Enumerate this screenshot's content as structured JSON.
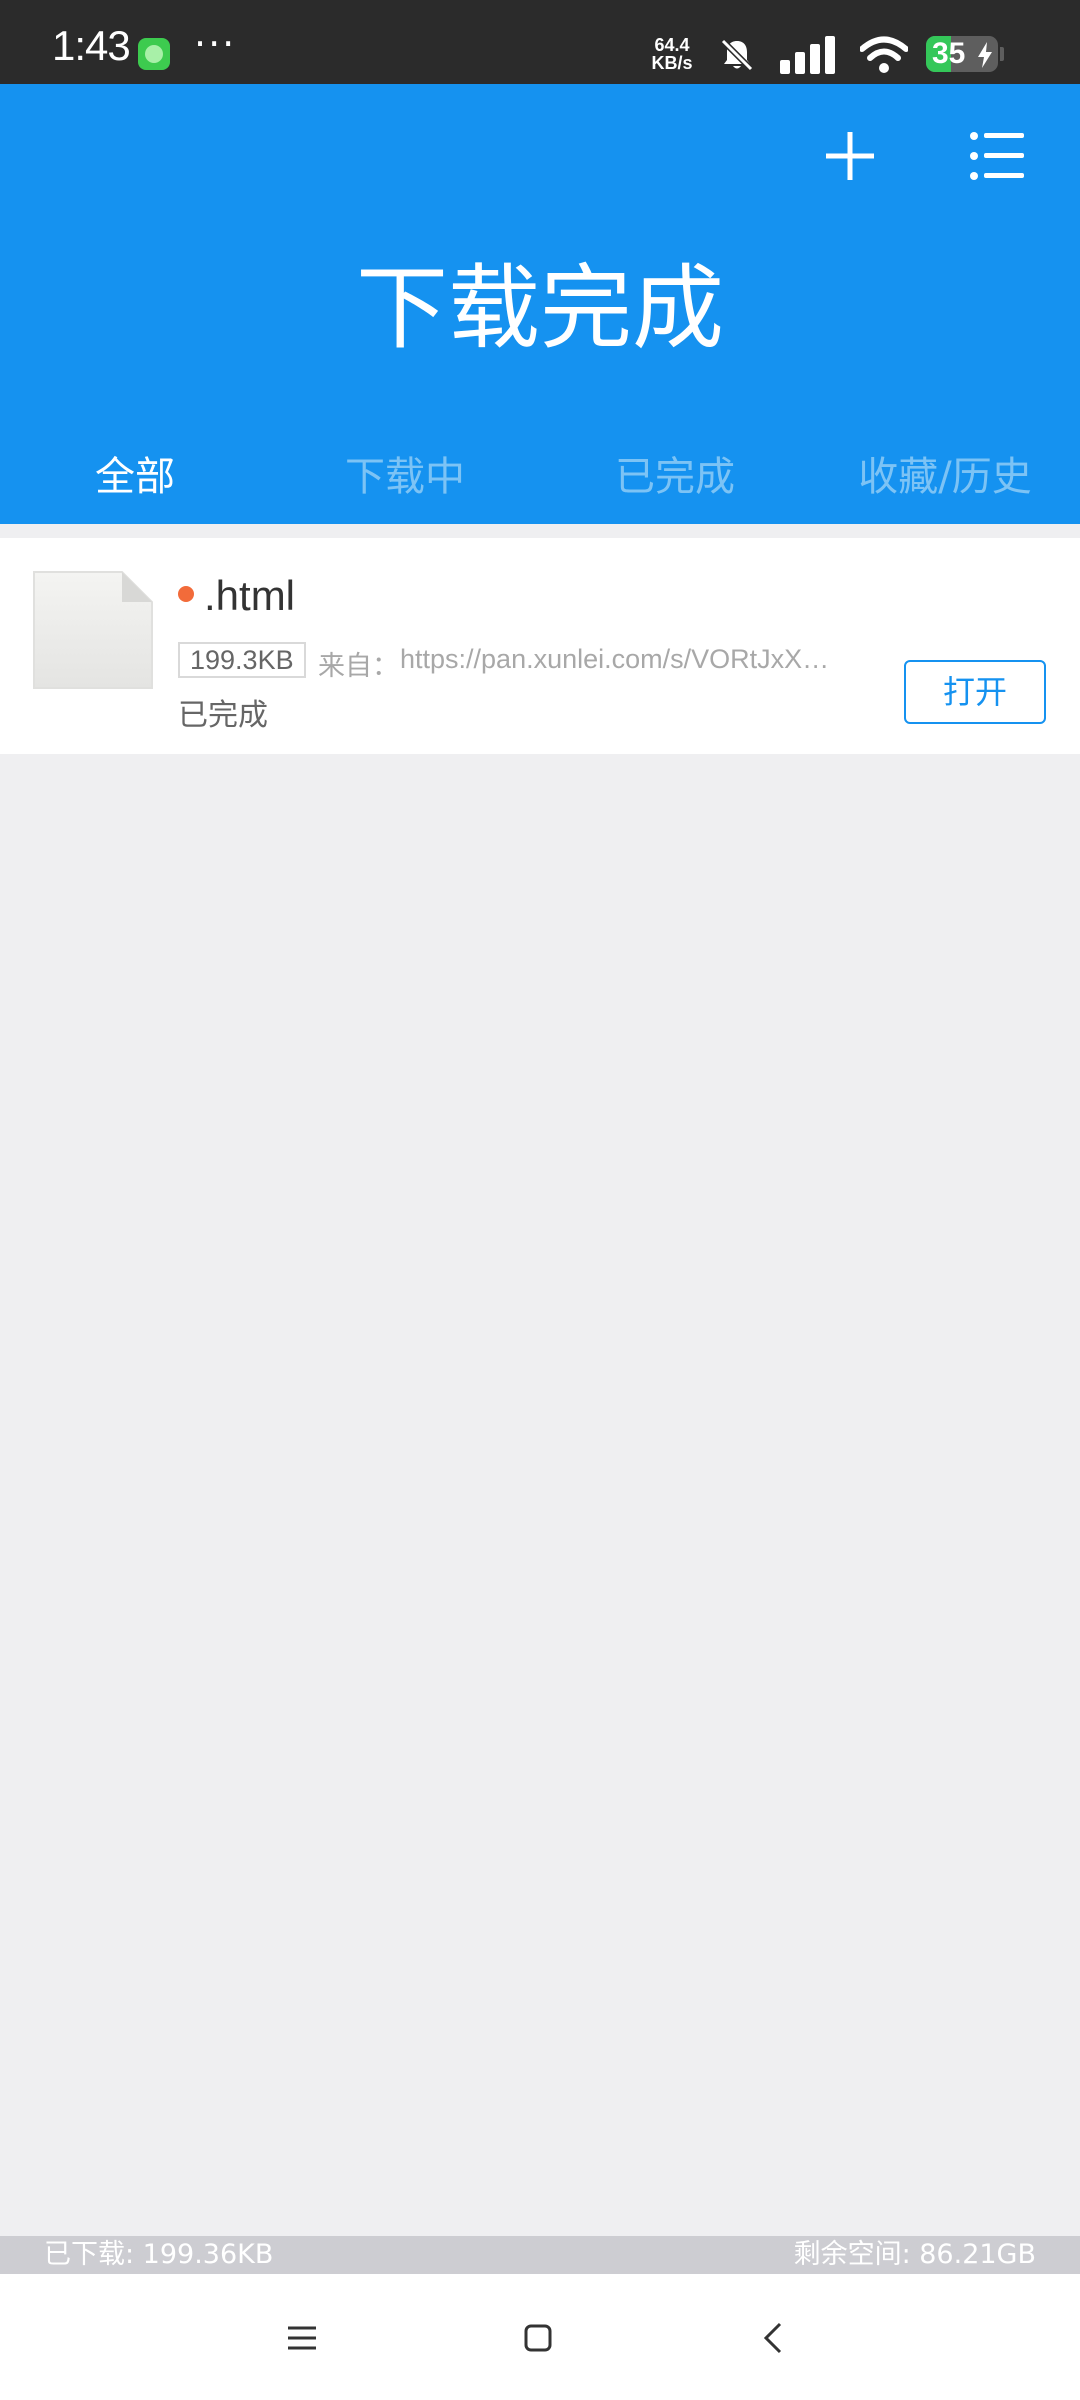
{
  "status_bar": {
    "time": "1:43",
    "more": "···",
    "net_speed_value": "64.4",
    "net_speed_unit": "KB/s",
    "battery": "35",
    "battery_level": 0.35,
    "icons": [
      "chat-notification-icon",
      "mute-bell-icon",
      "signal-icon",
      "wifi-icon",
      "charging-bolt-icon"
    ]
  },
  "header": {
    "title": "下载完成",
    "add_icon": "plus-icon",
    "menu_icon": "list-menu-icon",
    "accent_color": "#1592F0"
  },
  "tabs": [
    {
      "label": "全部",
      "active": true
    },
    {
      "label": "下载中",
      "active": false
    },
    {
      "label": "已完成",
      "active": false
    },
    {
      "label": "收藏/历史",
      "active": false
    }
  ],
  "downloads": [
    {
      "name": ".html",
      "size": "199.3KB",
      "source_label": "来自：",
      "source_url": "https://pan.xunlei.com/s/VORtJxX…",
      "status": "已完成",
      "action": "打开"
    }
  ],
  "storage": {
    "downloaded": "已下载: 199.36KB",
    "remaining": "剩余空间: 86.21GB"
  },
  "nav_bar": {
    "icons": [
      "menu-lines-icon",
      "home-square-icon",
      "back-chevron-icon"
    ]
  }
}
